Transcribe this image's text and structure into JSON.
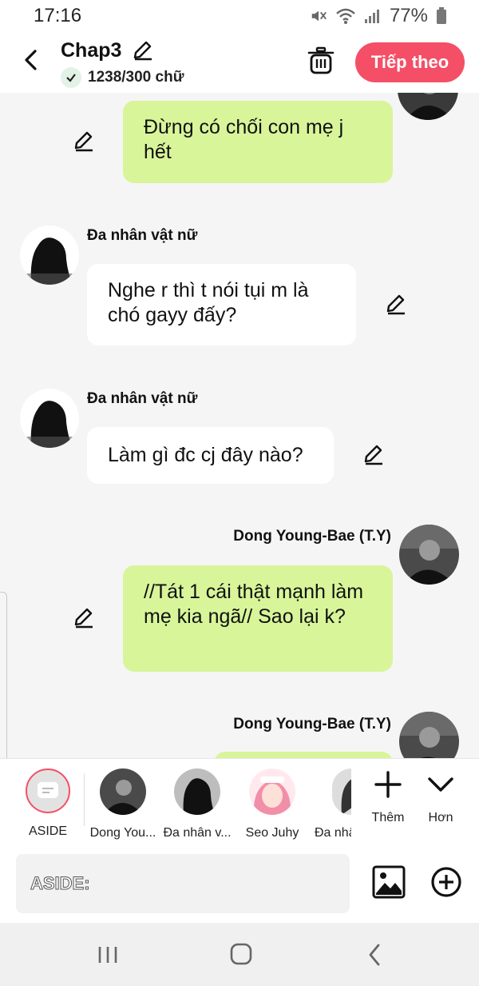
{
  "status": {
    "time": "17:16",
    "battery": "77%"
  },
  "header": {
    "title": "Chap3",
    "word_count": "1238/300 chữ",
    "next_label": "Tiếp theo"
  },
  "messages": [
    {
      "side": "right",
      "text": "Đừng có chối con mẹ j hết",
      "color": "#d8f59a"
    },
    {
      "side": "left",
      "speaker": "Đa nhân vật nữ",
      "text": "Nghe r thì t nói tụi m là chó gayy đấy?",
      "color": "#ffffff"
    },
    {
      "side": "left",
      "speaker": "Đa nhân vật nữ",
      "text": "Làm gì đc cj đây nào?",
      "color": "#ffffff"
    },
    {
      "side": "right",
      "speaker": "Dong Young-Bae (T.Y)",
      "text": "//Tát 1 cái thật mạnh làm mẹ kia ngã// Sao lại k?",
      "color": "#d8f59a"
    },
    {
      "side": "right",
      "speaker": "Dong Young-Bae (T.Y)",
      "text": "",
      "color": "#d8f59a"
    }
  ],
  "characters": [
    {
      "name": "ASIDE",
      "selected": true
    },
    {
      "name": "Dong Young-Bae (T.Y)",
      "short": "Dong You..."
    },
    {
      "name": "Đa nhân vật nữ",
      "short": "Đa nhân v..."
    },
    {
      "name": "Seo Juhy",
      "short": "Seo Juhy"
    },
    {
      "name": "Đa nhân",
      "short": "Đa nhâ"
    }
  ],
  "tools": {
    "add_label": "Thêm",
    "more_label": "Hơn"
  },
  "input": {
    "placeholder": "ASIDE:"
  },
  "colors": {
    "accent": "#f44f66",
    "bubble_green": "#d8f59a",
    "bubble_white": "#ffffff",
    "background": "#f5f5f5"
  }
}
